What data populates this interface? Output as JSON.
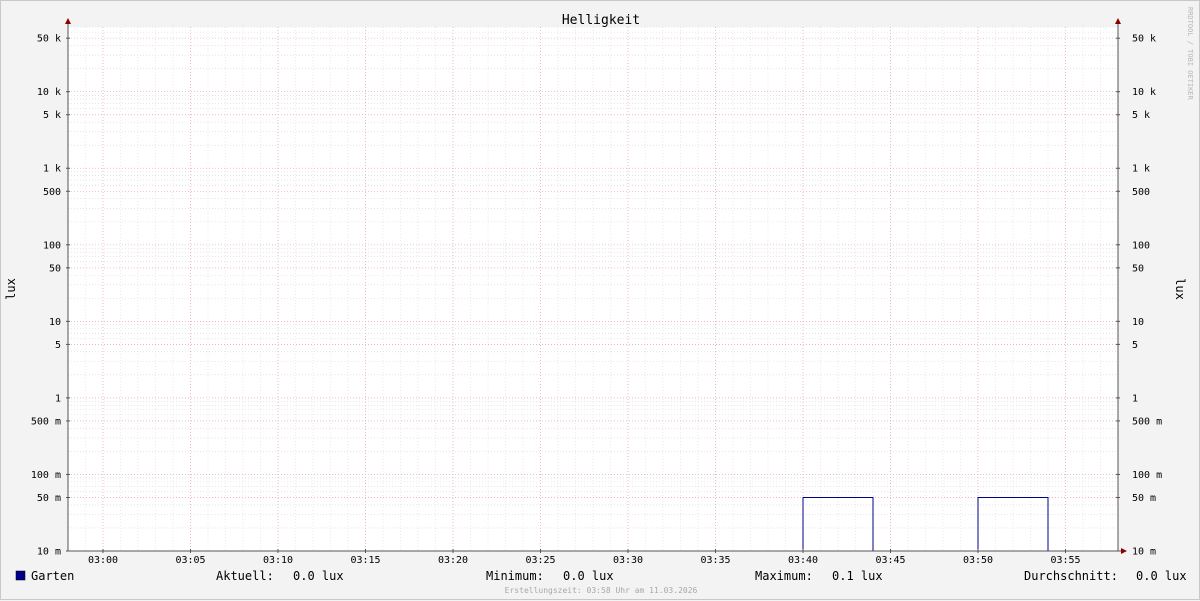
{
  "chart_data": {
    "type": "line",
    "title": "Helligkeit",
    "ylabel": "lux",
    "yscale": "log",
    "ylim": [
      0.01,
      70000
    ],
    "xlim": [
      "02:58",
      "03:58"
    ],
    "grid": true,
    "x_ticks": [
      "03:00",
      "03:05",
      "03:10",
      "03:15",
      "03:20",
      "03:25",
      "03:30",
      "03:35",
      "03:40",
      "03:45",
      "03:50",
      "03:55"
    ],
    "y_ticks": [
      {
        "value": 50000,
        "label": "50 k"
      },
      {
        "value": 10000,
        "label": "10 k"
      },
      {
        "value": 5000,
        "label": "5 k"
      },
      {
        "value": 1000,
        "label": "1 k"
      },
      {
        "value": 500,
        "label": "500"
      },
      {
        "value": 100,
        "label": "100"
      },
      {
        "value": 50,
        "label": "50"
      },
      {
        "value": 10,
        "label": "10"
      },
      {
        "value": 5,
        "label": "5"
      },
      {
        "value": 1,
        "label": "1"
      },
      {
        "value": 0.5,
        "label": "500 m"
      },
      {
        "value": 0.1,
        "label": "100 m"
      },
      {
        "value": 0.05,
        "label": "50 m"
      },
      {
        "value": 0.01,
        "label": "10 m"
      }
    ],
    "series": [
      {
        "name": "Garten",
        "color": "#00008b",
        "points": [
          {
            "x": "02:58",
            "y": 0.01
          },
          {
            "x": "03:40",
            "y": 0.01
          },
          {
            "x": "03:40",
            "y": 0.05
          },
          {
            "x": "03:44",
            "y": 0.05
          },
          {
            "x": "03:44",
            "y": 0.01
          },
          {
            "x": "03:50",
            "y": 0.01
          },
          {
            "x": "03:50",
            "y": 0.05
          },
          {
            "x": "03:54",
            "y": 0.05
          },
          {
            "x": "03:54",
            "y": 0.01
          },
          {
            "x": "03:58",
            "y": 0.01
          }
        ]
      }
    ],
    "legend": {
      "series_name": "Garten",
      "stats": [
        {
          "label": "Aktuell:",
          "value": "0.0 lux"
        },
        {
          "label": "Minimum:",
          "value": "0.0 lux"
        },
        {
          "label": "Maximum:",
          "value": "0.1 lux"
        },
        {
          "label": "Durchschnitt:",
          "value": "0.0 lux"
        }
      ]
    },
    "watermark": "RRDTOOL / TOBI OETIKER",
    "footer": "Erstellungszeit: 03:58 Uhr am 11.03.2026"
  }
}
